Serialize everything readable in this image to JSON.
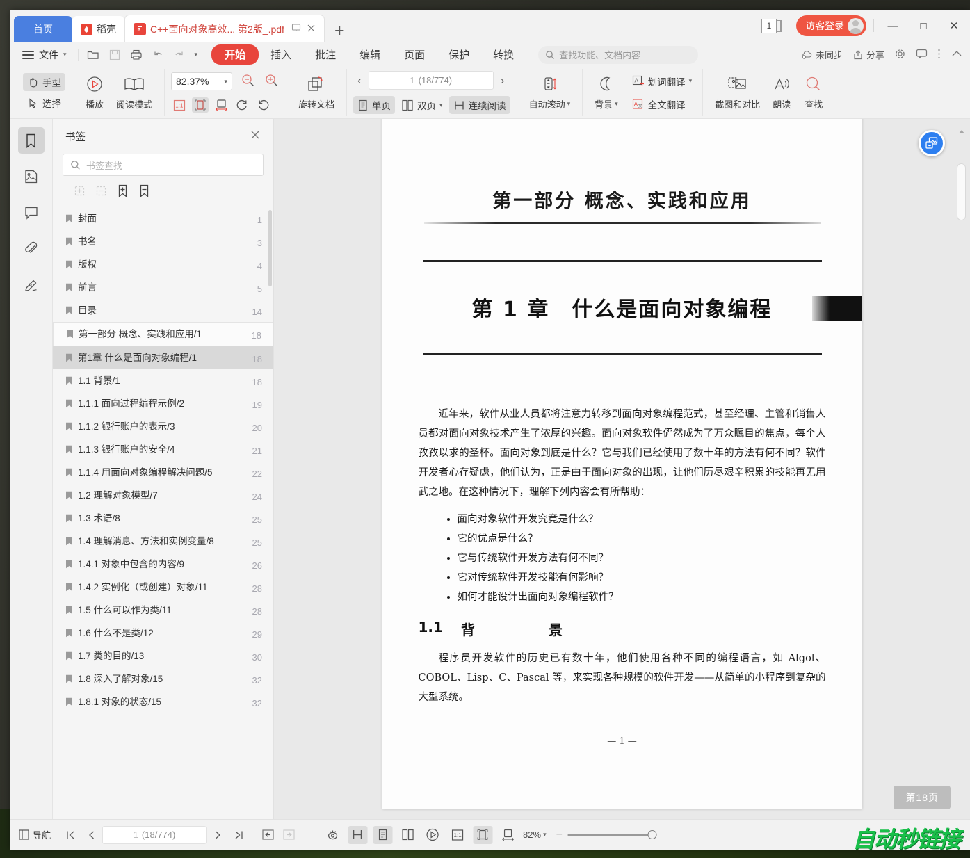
{
  "window": {
    "tabs": [
      {
        "label": "首页",
        "type": "home"
      },
      {
        "label": "稻壳",
        "type": "docer"
      },
      {
        "label": "C++面向对象高效... 第2版_.pdf",
        "type": "pdf",
        "active": true
      }
    ],
    "new_tab_label": "+",
    "page_count_badge": "1",
    "login_label": "访客登录",
    "minimize": "—",
    "maximize": "□",
    "close": "✕"
  },
  "menubar": {
    "file_label": "文件",
    "quick_icons": [
      "open-folder-icon",
      "save-icon",
      "print-icon",
      "undo-icon",
      "redo-icon",
      "customize-caret-icon"
    ],
    "ribbon_tabs": [
      {
        "label": "开始",
        "active": true
      },
      {
        "label": "插入",
        "active": false
      },
      {
        "label": "批注",
        "active": false
      },
      {
        "label": "编辑",
        "active": false
      },
      {
        "label": "页面",
        "active": false
      },
      {
        "label": "保护",
        "active": false
      },
      {
        "label": "转换",
        "active": false
      }
    ],
    "search_placeholder": "查找功能、文档内容",
    "right_items": [
      {
        "label": "未同步",
        "icon": "cloud-sync-icon"
      },
      {
        "label": "分享",
        "icon": "share-icon"
      },
      {
        "label": "",
        "icon": "gear-icon"
      },
      {
        "label": "",
        "icon": "feedback-icon"
      },
      {
        "label": "",
        "icon": "more-icon"
      },
      {
        "label": "",
        "icon": "collapse-ribbon-icon"
      }
    ]
  },
  "toolbar": {
    "hand_label": "手型",
    "select_label": "选择",
    "play_label": "播放",
    "read_mode_label": "阅读模式",
    "zoom_value": "82.37%",
    "zoom_out_icon": "zoom-out-icon",
    "zoom_in_icon": "zoom-in-icon",
    "fit_icons": [
      "actual-size-icon",
      "fit-page-icon",
      "fit-width-icon",
      "rotate-ccw-icon",
      "rotate-cw-icon"
    ],
    "rotate_doc_label": "旋转文档",
    "page_prev": "‹",
    "page_next": "›",
    "page_value": "1",
    "page_total": "(18/774)",
    "single_page_label": "单页",
    "double_page_label": "双页",
    "continuous_label": "连续阅读",
    "auto_scroll_label": "自动滚动",
    "background_label": "背景",
    "word_translate_label": "划词翻译",
    "full_translate_label": "全文翻译",
    "screenshot_compare_label": "截图和对比",
    "read_aloud_label": "朗读",
    "find_label": "查找"
  },
  "rail": {
    "items": [
      {
        "icon": "bookmark-icon",
        "active": true
      },
      {
        "icon": "thumbnail-icon",
        "active": false
      },
      {
        "icon": "comment-icon",
        "active": false
      },
      {
        "icon": "attachment-icon",
        "active": false
      },
      {
        "icon": "signature-icon",
        "active": false
      }
    ]
  },
  "panel": {
    "title": "书签",
    "close_icon": "close-icon",
    "search_placeholder": "书签查找",
    "tool_icons": [
      "expand-all-icon",
      "collapse-all-icon",
      "add-bookmark-icon",
      "remove-bookmark-icon"
    ],
    "bookmarks": [
      {
        "text": "封面",
        "page": "1",
        "state": "normal"
      },
      {
        "text": "书名",
        "page": "3",
        "state": "normal"
      },
      {
        "text": "版权",
        "page": "4",
        "state": "normal"
      },
      {
        "text": "前言",
        "page": "5",
        "state": "normal"
      },
      {
        "text": "目录",
        "page": "14",
        "state": "normal"
      },
      {
        "text": "第一部分 概念、实践和应用/1",
        "page": "18",
        "state": "hl"
      },
      {
        "text": "第1章 什么是面向对象编程/1",
        "page": "18",
        "state": "sel"
      },
      {
        "text": "1.1 背景/1",
        "page": "18",
        "state": "normal"
      },
      {
        "text": "1.1.1 面向过程编程示例/2",
        "page": "19",
        "state": "normal"
      },
      {
        "text": "1.1.2 银行账户的表示/3",
        "page": "20",
        "state": "normal"
      },
      {
        "text": "1.1.3 银行账户的安全/4",
        "page": "21",
        "state": "normal"
      },
      {
        "text": "1.1.4 用面向对象编程解决问题/5",
        "page": "22",
        "state": "normal"
      },
      {
        "text": "1.2 理解对象模型/7",
        "page": "24",
        "state": "normal"
      },
      {
        "text": "1.3 术语/8",
        "page": "25",
        "state": "normal"
      },
      {
        "text": "1.4 理解消息、方法和实例变量/8",
        "page": "25",
        "state": "normal"
      },
      {
        "text": "1.4.1 对象中包含的内容/9",
        "page": "26",
        "state": "normal"
      },
      {
        "text": "1.4.2 实例化（或创建）对象/11",
        "page": "28",
        "state": "normal"
      },
      {
        "text": "1.5 什么可以作为类/11",
        "page": "28",
        "state": "normal"
      },
      {
        "text": "1.6 什么不是类/12",
        "page": "29",
        "state": "normal"
      },
      {
        "text": "1.7 类的目的/13",
        "page": "30",
        "state": "normal"
      },
      {
        "text": "1.8 深入了解对象/15",
        "page": "32",
        "state": "normal"
      },
      {
        "text": "1.8.1 对象的状态/15",
        "page": "32",
        "state": "normal"
      }
    ]
  },
  "document": {
    "part_title": "第一部分  概念、实践和应用",
    "chapter_title": "第 1 章　什么是面向对象编程",
    "paragraph_1": "近年来，软件从业人员都将注意力转移到面向对象编程范式，甚至经理、主管和销售人员都对面向对象技术产生了浓厚的兴趣。面向对象软件俨然成为了万众瞩目的焦点，每个人孜孜以求的圣杯。面向对象到底是什么？它与我们已经使用了数十年的方法有何不同？软件开发者心存疑虑，他们认为，正是由于面向对象的出现，让他们历尽艰辛积累的技能再无用武之地。在这种情况下，理解下列内容会有所帮助：",
    "bullets": [
      "面向对象软件开发究竟是什么？",
      "它的优点是什么？",
      "它与传统软件开发方法有何不同？",
      "它对传统软件开发技能有何影响？",
      "如何才能设计出面向对象编程软件？"
    ],
    "section_number": "1.1",
    "section_title": "背　　景",
    "paragraph_2": "程序员开发软件的历史已有数十年，他们使用各种不同的编程语言，如 Algol、COBOL、Lisp、C、Pascal 等，来实现各种规模的软件开发——从简单的小程序到复杂的大型系统。",
    "folio": "— 1 —",
    "page_badge": "第18页",
    "fab_icon": "pdf-to-word-icon"
  },
  "status": {
    "nav_label": "导航",
    "first_icon": "first-page-icon",
    "prev_icon": "prev-page-icon",
    "page_value": "1",
    "page_total": "(18/774)",
    "next_icon": "next-page-icon",
    "last_icon": "last-page-icon",
    "back_icon": "back-icon",
    "forward_icon": "forward-icon",
    "eye_icon": "eye-protection-icon",
    "continuous_icon": "continuous-scroll-icon",
    "single_icon": "single-page-icon",
    "double_icon": "double-page-icon",
    "play_icon": "slideshow-icon",
    "actual_icon": "actual-size-icon",
    "fit_page_icon": "fit-page-icon",
    "fit_width_icon": "fit-width-icon",
    "zoom_value": "82%",
    "zoom_minus": "−",
    "watermark": "自动秒链接"
  },
  "colors": {
    "accent_red": "#e8453c",
    "tab_blue": "#4a7fe0",
    "login_red": "#ef5542",
    "fab_blue": "#2d7ff0",
    "watermark_green": "#19c04a"
  }
}
